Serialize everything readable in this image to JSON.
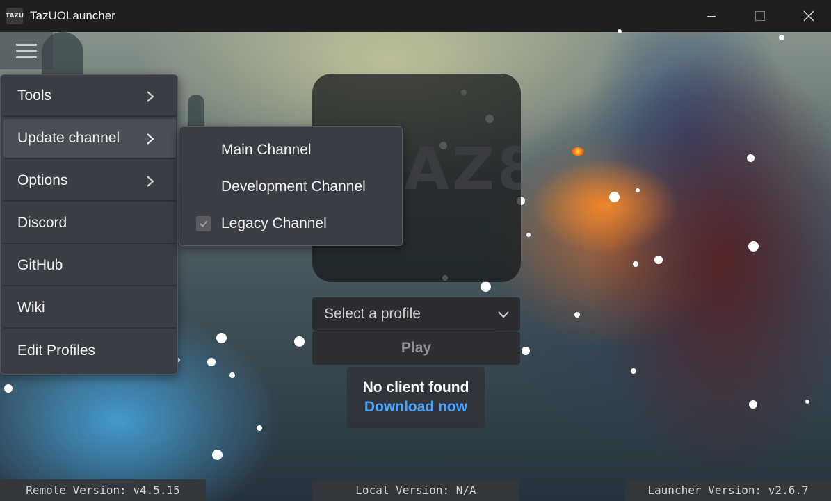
{
  "window": {
    "icon_text": "TAZU",
    "title": "TazUOLauncher"
  },
  "menu": {
    "items": [
      {
        "label": "Tools",
        "has_submenu": true
      },
      {
        "label": "Update channel",
        "has_submenu": true
      },
      {
        "label": "Options",
        "has_submenu": true
      },
      {
        "label": "Discord",
        "has_submenu": false
      },
      {
        "label": "GitHub",
        "has_submenu": false
      },
      {
        "label": "Wiki",
        "has_submenu": false
      },
      {
        "label": "Edit Profiles",
        "has_submenu": false
      }
    ],
    "active_item": "Update channel"
  },
  "update_channel_submenu": {
    "items": [
      {
        "label": "Main Channel",
        "checked": false
      },
      {
        "label": "Development Channel",
        "checked": false
      },
      {
        "label": "Legacy Channel",
        "checked": true
      }
    ]
  },
  "logo": {
    "text": "AZ8"
  },
  "profile": {
    "placeholder": "Select a profile"
  },
  "play": {
    "label": "Play",
    "enabled": false
  },
  "notice": {
    "title": "No client found",
    "link": "Download now"
  },
  "footer": {
    "remote_version": "Remote Version: v4.5.15",
    "local_version": "Local Version: N/A",
    "launcher_version": "Launcher Version: v2.6.7"
  },
  "colors": {
    "link": "#4aa3ff",
    "menu_bg": "#3b3d44",
    "titlebar_bg": "#1f1f1f"
  }
}
